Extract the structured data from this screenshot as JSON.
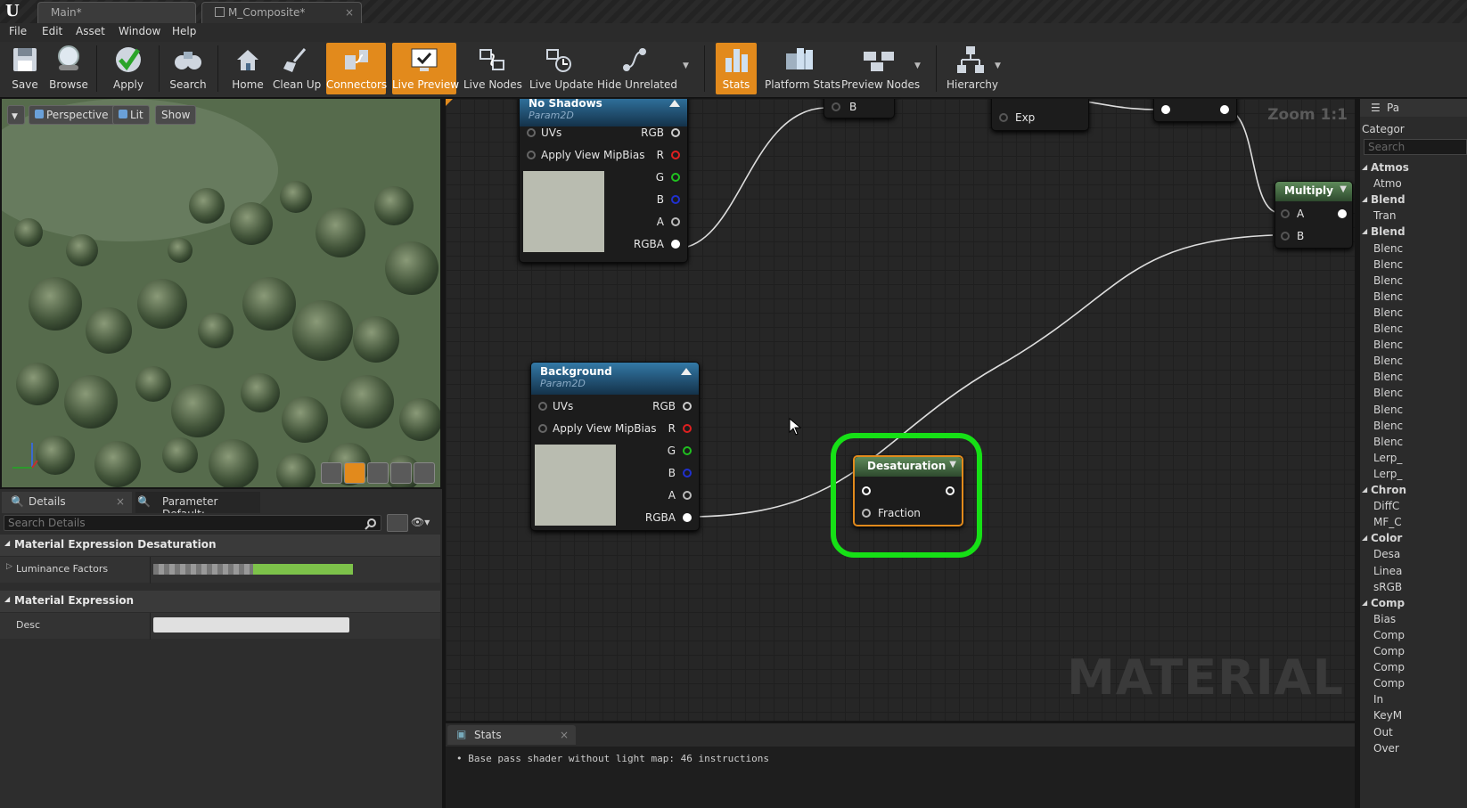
{
  "tabs": [
    {
      "label": "Main*"
    },
    {
      "label": "M_Composite*",
      "close": "×"
    }
  ],
  "menu": [
    "File",
    "Edit",
    "Asset",
    "Window",
    "Help"
  ],
  "toolbar": {
    "save": "Save",
    "browse": "Browse",
    "apply": "Apply",
    "search": "Search",
    "home": "Home",
    "cleanup": "Clean Up",
    "connectors": "Connectors",
    "live_preview": "Live Preview",
    "live_nodes": "Live Nodes",
    "live_update": "Live Update",
    "hide_unrelated": "Hide Unrelated",
    "stats": "Stats",
    "platform_stats": "Platform Stats",
    "preview_nodes": "Preview Nodes",
    "hierarchy": "Hierarchy"
  },
  "viewport": {
    "perspective": "Perspective",
    "lit": "Lit",
    "show": "Show"
  },
  "details": {
    "tab_details": "Details",
    "tab_close": "×",
    "tab_params": "Parameter Default:",
    "search_placeholder": "Search Details",
    "section1": "Material Expression Desaturation",
    "luminance_label": "Luminance Factors",
    "section2": "Material Expression",
    "desc_label": "Desc"
  },
  "graph": {
    "zoom": "Zoom 1:1",
    "watermark": "MATERIAL",
    "node_noshadows": {
      "title": "No Shadows",
      "subtitle": "Param2D",
      "uvs": "UVs",
      "mip": "Apply View MipBias",
      "rgb": "RGB",
      "r": "R",
      "g": "G",
      "b": "B",
      "a": "A",
      "rgba": "RGBA"
    },
    "node_background": {
      "title": "Background",
      "subtitle": "Param2D",
      "uvs": "UVs",
      "mip": "Apply View MipBias",
      "rgb": "RGB",
      "r": "R",
      "g": "G",
      "b": "B",
      "a": "A",
      "rgba": "RGBA"
    },
    "node_b": {
      "pin": "B"
    },
    "node_exp": {
      "pin": "Exp"
    },
    "node_multiply": {
      "title": "Multiply",
      "a": "A",
      "b": "B"
    },
    "node_desat": {
      "title": "Desaturation",
      "fraction": "Fraction"
    }
  },
  "palette": {
    "header": "Pa",
    "category": "Categor",
    "search": "Search",
    "items": [
      "Atmos",
      "Atmo",
      "Blend",
      "Tran",
      "Blend",
      "Blenc",
      "Blenc",
      "Blenc",
      "Blenc",
      "Blenc",
      "Blenc",
      "Blenc",
      "Blenc",
      "Blenc",
      "Blenc",
      "Blenc",
      "Blenc",
      "Blenc",
      "Lerp_",
      "Lerp_",
      "Chron",
      "DiffC",
      "MF_C",
      "Color",
      "Desa",
      "Linea",
      "sRGB",
      "Comp",
      "Bias",
      "Comp",
      "Comp",
      "Comp",
      "Comp",
      "In",
      "KeyM",
      "Out",
      "Over"
    ]
  },
  "stats": {
    "tab": "Stats",
    "close": "×",
    "line": "Base pass shader without light map: 46 instructions"
  },
  "colors": {
    "accent": "#e28a1c",
    "highlight": "#16e016",
    "node_header": "#2d6a93"
  }
}
